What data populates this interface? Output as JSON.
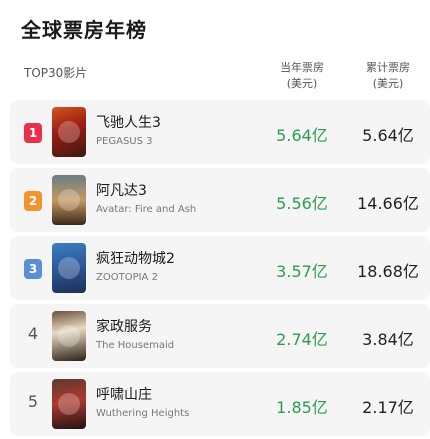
{
  "page": {
    "title": "全球票房年榜",
    "header": {
      "left": "TOP30影片",
      "year_line1": "当年票房",
      "year_line2": "(美元)",
      "total_line1": "累计票房",
      "total_line2": "(美元)"
    }
  },
  "movies": [
    {
      "rank": "1",
      "name_cn": "飞驰人生3",
      "name_en": "PEGASUS 3",
      "year_box": "5.64亿",
      "total_box": "5.64亿"
    },
    {
      "rank": "2",
      "name_cn": "阿凡达3",
      "name_en": "Avatar: Fire and Ash",
      "year_box": "5.56亿",
      "total_box": "14.66亿"
    },
    {
      "rank": "3",
      "name_cn": "疯狂动物城2",
      "name_en": "ZOOTOPIA 2",
      "year_box": "3.57亿",
      "total_box": "18.68亿"
    },
    {
      "rank": "4",
      "name_cn": "家政服务",
      "name_en": "The Housemaid",
      "year_box": "2.74亿",
      "total_box": "3.84亿"
    },
    {
      "rank": "5",
      "name_cn": "呼啸山庄",
      "name_en": "Wuthering Heights",
      "year_box": "1.85亿",
      "total_box": "2.17亿"
    }
  ],
  "colors": {
    "rank1": "#e8304a",
    "rank2": "#f3932e",
    "rank3": "#5a8fd6",
    "year_box_text": "#2e9c4d"
  }
}
